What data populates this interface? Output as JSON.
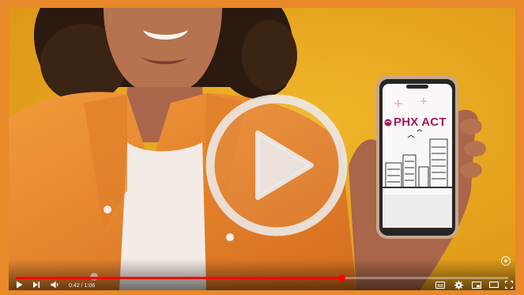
{
  "player": {
    "state": "paused",
    "progress_fraction": 0.662,
    "time_current": "0:42",
    "time_separator": "/",
    "time_total": "1:06"
  },
  "phone_screen": {
    "brand_text": "PHX ACT"
  },
  "icons": {
    "play_overlay": "play-circle-icon",
    "play": "play-icon",
    "next": "next-icon",
    "volume": "volume-icon",
    "subtitles": "subtitles-icon",
    "settings": "gear-icon",
    "miniplayer": "miniplayer-icon",
    "theater": "theater-mode-icon",
    "fullscreen": "fullscreen-icon",
    "corner": "channel-watermark-icon"
  },
  "colors": {
    "frame": "#e8892a",
    "background": "#e5a31c",
    "progress": "#ff0000",
    "brand": "#a3195b"
  }
}
